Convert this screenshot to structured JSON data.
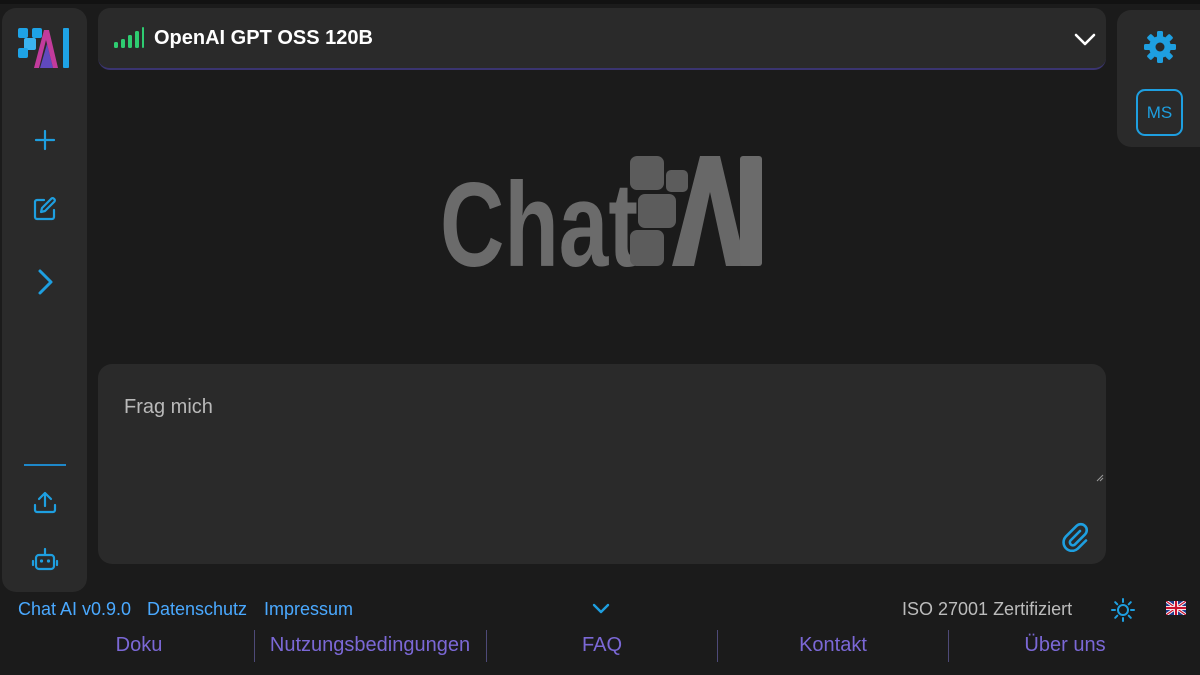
{
  "app": {
    "logo_alt": "Chat AI logo",
    "brand": "Chat AI"
  },
  "sidebar": {
    "items": [
      {
        "name": "new-chat-button",
        "icon": "plus-icon"
      },
      {
        "name": "edit-button",
        "icon": "edit-icon"
      },
      {
        "name": "expand-sidebar-button",
        "icon": "chevron-right-icon"
      },
      {
        "name": "upload-button",
        "icon": "upload-icon"
      },
      {
        "name": "bot-button",
        "icon": "robot-icon"
      }
    ]
  },
  "model_selector": {
    "label": "OpenAI GPT OSS 120B",
    "signal_color": "#2ecc71",
    "icon": "signal-bars-icon"
  },
  "user": {
    "initials": "MS"
  },
  "prompt": {
    "placeholder": "Frag mich",
    "value": ""
  },
  "footer": {
    "version": "Chat AI v0.9.0",
    "privacy": "Datenschutz",
    "imprint": "Impressum",
    "iso": "ISO 27001 Zertifiziert",
    "links": [
      "Doku",
      "Nutzungsbedingungen",
      "FAQ",
      "Kontakt",
      "Über uns"
    ]
  },
  "colors": {
    "accent": "#1e9fe0",
    "link": "#4aa9ff",
    "footer_link": "#7b68d6",
    "background": "#1b1b1b",
    "panel": "#2a2a2a"
  }
}
